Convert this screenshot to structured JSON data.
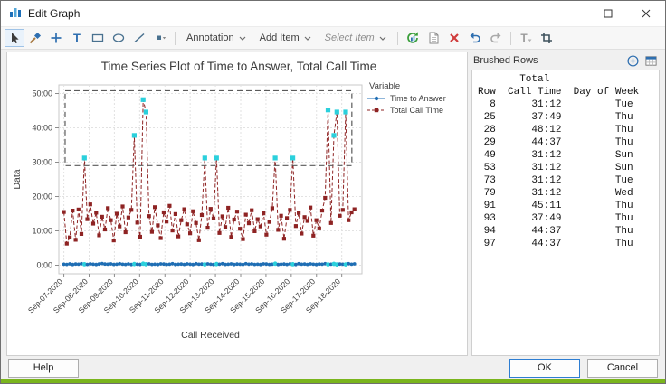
{
  "window": {
    "title": "Edit Graph"
  },
  "toolbar": {
    "annotation_label": "Annotation",
    "add_item_label": "Add Item",
    "select_item_placeholder": "Select Item"
  },
  "chart_data": {
    "type": "line",
    "title": "Time Series Plot of Time to Answer, Total Call Time",
    "xlabel": "Call Received",
    "ylabel": "Data",
    "legend_title": "Variable",
    "legend_position": "right-top",
    "grid": true,
    "x_tick_values": [
      7,
      8,
      9,
      10,
      11,
      12,
      13,
      14,
      15,
      16,
      17,
      18
    ],
    "x_tick_labels": [
      "Sep-07-2020",
      "Sep-08-2020",
      "Sep-09-2020",
      "Sep-10-2020",
      "Sep-11-2020",
      "Sep-12-2020",
      "Sep-13-2020",
      "Sep-14-2020",
      "Sep-15-2020",
      "Sep-16-2020",
      "Sep-17-2020",
      "Sep-18-2020"
    ],
    "y_tick_values": [
      0,
      10,
      20,
      30,
      40,
      50
    ],
    "y_tick_labels": [
      "0:00",
      "10:00",
      "20:00",
      "30:00",
      "40:00",
      "50:00"
    ],
    "xlim": [
      6.8,
      18.8
    ],
    "ylim": [
      -2.5,
      52.5
    ],
    "x_start": 7.0,
    "x_step": 0.1162,
    "series": [
      {
        "name": "Time to Answer",
        "color": "#1f6eb4",
        "marker": "circle",
        "line": "solid",
        "values": [
          0.3,
          0.25,
          0.4,
          0.2,
          0.35,
          0.3,
          0.45,
          0.3,
          0.25,
          0.4,
          0.3,
          0.2,
          0.35,
          0.5,
          0.35,
          0.3,
          0.4,
          0.25,
          0.3,
          0.45,
          0.3,
          0.25,
          0.4,
          0.2,
          0.35,
          0.3,
          0.25,
          0.45,
          0.3,
          0.4,
          0.25,
          0.3,
          0.2,
          0.4,
          0.35,
          0.25,
          0.3,
          0.45,
          0.2,
          0.3,
          0.35,
          0.25,
          0.4,
          0.3,
          0.2,
          0.45,
          0.3,
          0.35,
          0.25,
          0.4,
          0.3,
          0.2,
          0.35,
          0.3,
          0.45,
          0.25,
          0.3,
          0.4,
          0.2,
          0.35,
          0.3,
          0.25,
          0.45,
          0.3,
          0.4,
          0.25,
          0.3,
          0.2,
          0.4,
          0.35,
          0.25,
          0.3,
          0.45,
          0.2,
          0.3,
          0.35,
          0.25,
          0.4,
          0.3,
          0.2,
          0.45,
          0.3,
          0.35,
          0.25,
          0.4,
          0.3,
          0.2,
          0.35,
          0.3,
          0.45,
          0.25,
          0.3,
          0.4,
          0.2,
          0.35,
          0.3,
          0.25,
          0.45,
          0.3,
          0.4
        ]
      },
      {
        "name": "Total Call Time",
        "color": "#8e2323",
        "marker": "square",
        "line": "dashed",
        "values": [
          15.5,
          6.3,
          8.1,
          15.9,
          7.4,
          16.2,
          9.1,
          31.2,
          13.4,
          17.7,
          12.1,
          15.3,
          8.7,
          14.1,
          10.4,
          16.6,
          13.1,
          7.2,
          15.0,
          11.3,
          17.1,
          9.6,
          13.9,
          16.1,
          37.8,
          12.4,
          8.3,
          48.2,
          44.6,
          14.3,
          9.7,
          16.9,
          11.6,
          7.9,
          15.4,
          12.7,
          17.3,
          10.1,
          14.9,
          8.4,
          13.1,
          16.3,
          11.9,
          9.3,
          15.7,
          12.3,
          7.3,
          14.6,
          31.2,
          10.9,
          16.4,
          13.6,
          31.2,
          9.4,
          14.2,
          11.1,
          16.7,
          8.2,
          13.3,
          15.6,
          10.6,
          7.6,
          14.7,
          12.2,
          16.0,
          9.9,
          13.4,
          11.3,
          15.1,
          8.9,
          12.6,
          16.6,
          31.2,
          10.3,
          14.4,
          7.7,
          13.7,
          16.1,
          31.2,
          11.4,
          15.2,
          9.2,
          14.0,
          12.9,
          16.8,
          8.6,
          13.1,
          10.7,
          15.9,
          19.6,
          45.2,
          12.3,
          37.8,
          44.6,
          14.4,
          16.1,
          44.6,
          13.1,
          15.4,
          16.3
        ]
      }
    ],
    "brushed_indices": [
      8,
      25,
      28,
      29,
      49,
      53,
      73,
      79,
      91,
      93,
      94,
      97
    ],
    "brush_color": "#2bd0dc",
    "brush_rect": {
      "x1": 7.05,
      "x2": 18.4,
      "y1": 29,
      "y2": 50.8
    }
  },
  "brushed_panel": {
    "title": "Brushed Rows",
    "col_group_header": "Total",
    "columns": [
      "Row",
      "Call Time",
      "Day of Week"
    ],
    "rows": [
      [
        "8",
        "31:12",
        "Tue"
      ],
      [
        "25",
        "37:49",
        "Thu"
      ],
      [
        "28",
        "48:12",
        "Thu"
      ],
      [
        "29",
        "44:37",
        "Thu"
      ],
      [
        "49",
        "31:12",
        "Sun"
      ],
      [
        "53",
        "31:12",
        "Sun"
      ],
      [
        "73",
        "31:12",
        "Tue"
      ],
      [
        "79",
        "31:12",
        "Wed"
      ],
      [
        "91",
        "45:11",
        "Thu"
      ],
      [
        "93",
        "37:49",
        "Thu"
      ],
      [
        "94",
        "44:37",
        "Thu"
      ],
      [
        "97",
        "44:37",
        "Thu"
      ]
    ]
  },
  "footer": {
    "help_label": "Help",
    "ok_label": "OK",
    "cancel_label": "Cancel"
  }
}
